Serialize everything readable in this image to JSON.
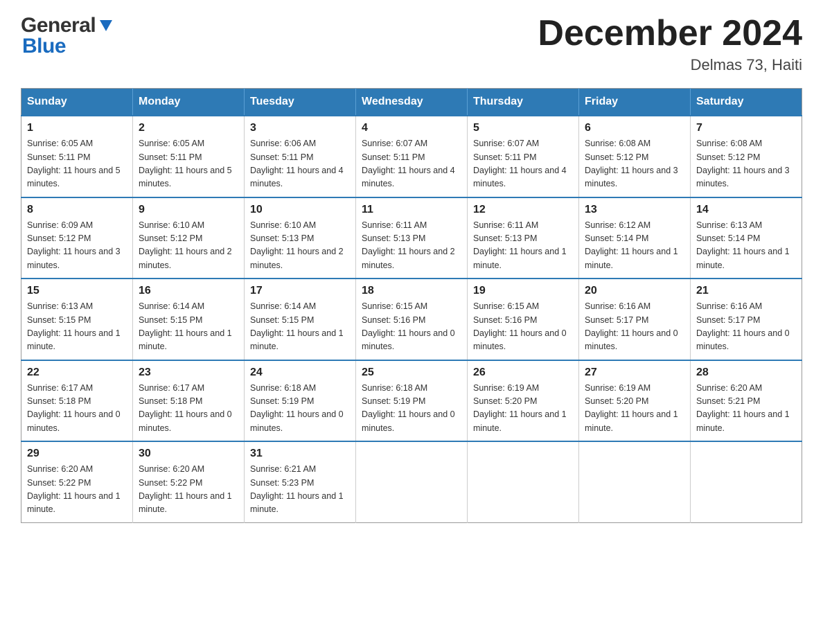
{
  "header": {
    "logo": {
      "general": "General",
      "blue": "Blue"
    },
    "title": "December 2024",
    "location": "Delmas 73, Haiti"
  },
  "calendar": {
    "days_of_week": [
      "Sunday",
      "Monday",
      "Tuesday",
      "Wednesday",
      "Thursday",
      "Friday",
      "Saturday"
    ],
    "weeks": [
      [
        {
          "day": "1",
          "sunrise": "Sunrise: 6:05 AM",
          "sunset": "Sunset: 5:11 PM",
          "daylight": "Daylight: 11 hours and 5 minutes."
        },
        {
          "day": "2",
          "sunrise": "Sunrise: 6:05 AM",
          "sunset": "Sunset: 5:11 PM",
          "daylight": "Daylight: 11 hours and 5 minutes."
        },
        {
          "day": "3",
          "sunrise": "Sunrise: 6:06 AM",
          "sunset": "Sunset: 5:11 PM",
          "daylight": "Daylight: 11 hours and 4 minutes."
        },
        {
          "day": "4",
          "sunrise": "Sunrise: 6:07 AM",
          "sunset": "Sunset: 5:11 PM",
          "daylight": "Daylight: 11 hours and 4 minutes."
        },
        {
          "day": "5",
          "sunrise": "Sunrise: 6:07 AM",
          "sunset": "Sunset: 5:11 PM",
          "daylight": "Daylight: 11 hours and 4 minutes."
        },
        {
          "day": "6",
          "sunrise": "Sunrise: 6:08 AM",
          "sunset": "Sunset: 5:12 PM",
          "daylight": "Daylight: 11 hours and 3 minutes."
        },
        {
          "day": "7",
          "sunrise": "Sunrise: 6:08 AM",
          "sunset": "Sunset: 5:12 PM",
          "daylight": "Daylight: 11 hours and 3 minutes."
        }
      ],
      [
        {
          "day": "8",
          "sunrise": "Sunrise: 6:09 AM",
          "sunset": "Sunset: 5:12 PM",
          "daylight": "Daylight: 11 hours and 3 minutes."
        },
        {
          "day": "9",
          "sunrise": "Sunrise: 6:10 AM",
          "sunset": "Sunset: 5:12 PM",
          "daylight": "Daylight: 11 hours and 2 minutes."
        },
        {
          "day": "10",
          "sunrise": "Sunrise: 6:10 AM",
          "sunset": "Sunset: 5:13 PM",
          "daylight": "Daylight: 11 hours and 2 minutes."
        },
        {
          "day": "11",
          "sunrise": "Sunrise: 6:11 AM",
          "sunset": "Sunset: 5:13 PM",
          "daylight": "Daylight: 11 hours and 2 minutes."
        },
        {
          "day": "12",
          "sunrise": "Sunrise: 6:11 AM",
          "sunset": "Sunset: 5:13 PM",
          "daylight": "Daylight: 11 hours and 1 minute."
        },
        {
          "day": "13",
          "sunrise": "Sunrise: 6:12 AM",
          "sunset": "Sunset: 5:14 PM",
          "daylight": "Daylight: 11 hours and 1 minute."
        },
        {
          "day": "14",
          "sunrise": "Sunrise: 6:13 AM",
          "sunset": "Sunset: 5:14 PM",
          "daylight": "Daylight: 11 hours and 1 minute."
        }
      ],
      [
        {
          "day": "15",
          "sunrise": "Sunrise: 6:13 AM",
          "sunset": "Sunset: 5:15 PM",
          "daylight": "Daylight: 11 hours and 1 minute."
        },
        {
          "day": "16",
          "sunrise": "Sunrise: 6:14 AM",
          "sunset": "Sunset: 5:15 PM",
          "daylight": "Daylight: 11 hours and 1 minute."
        },
        {
          "day": "17",
          "sunrise": "Sunrise: 6:14 AM",
          "sunset": "Sunset: 5:15 PM",
          "daylight": "Daylight: 11 hours and 1 minute."
        },
        {
          "day": "18",
          "sunrise": "Sunrise: 6:15 AM",
          "sunset": "Sunset: 5:16 PM",
          "daylight": "Daylight: 11 hours and 0 minutes."
        },
        {
          "day": "19",
          "sunrise": "Sunrise: 6:15 AM",
          "sunset": "Sunset: 5:16 PM",
          "daylight": "Daylight: 11 hours and 0 minutes."
        },
        {
          "day": "20",
          "sunrise": "Sunrise: 6:16 AM",
          "sunset": "Sunset: 5:17 PM",
          "daylight": "Daylight: 11 hours and 0 minutes."
        },
        {
          "day": "21",
          "sunrise": "Sunrise: 6:16 AM",
          "sunset": "Sunset: 5:17 PM",
          "daylight": "Daylight: 11 hours and 0 minutes."
        }
      ],
      [
        {
          "day": "22",
          "sunrise": "Sunrise: 6:17 AM",
          "sunset": "Sunset: 5:18 PM",
          "daylight": "Daylight: 11 hours and 0 minutes."
        },
        {
          "day": "23",
          "sunrise": "Sunrise: 6:17 AM",
          "sunset": "Sunset: 5:18 PM",
          "daylight": "Daylight: 11 hours and 0 minutes."
        },
        {
          "day": "24",
          "sunrise": "Sunrise: 6:18 AM",
          "sunset": "Sunset: 5:19 PM",
          "daylight": "Daylight: 11 hours and 0 minutes."
        },
        {
          "day": "25",
          "sunrise": "Sunrise: 6:18 AM",
          "sunset": "Sunset: 5:19 PM",
          "daylight": "Daylight: 11 hours and 0 minutes."
        },
        {
          "day": "26",
          "sunrise": "Sunrise: 6:19 AM",
          "sunset": "Sunset: 5:20 PM",
          "daylight": "Daylight: 11 hours and 1 minute."
        },
        {
          "day": "27",
          "sunrise": "Sunrise: 6:19 AM",
          "sunset": "Sunset: 5:20 PM",
          "daylight": "Daylight: 11 hours and 1 minute."
        },
        {
          "day": "28",
          "sunrise": "Sunrise: 6:20 AM",
          "sunset": "Sunset: 5:21 PM",
          "daylight": "Daylight: 11 hours and 1 minute."
        }
      ],
      [
        {
          "day": "29",
          "sunrise": "Sunrise: 6:20 AM",
          "sunset": "Sunset: 5:22 PM",
          "daylight": "Daylight: 11 hours and 1 minute."
        },
        {
          "day": "30",
          "sunrise": "Sunrise: 6:20 AM",
          "sunset": "Sunset: 5:22 PM",
          "daylight": "Daylight: 11 hours and 1 minute."
        },
        {
          "day": "31",
          "sunrise": "Sunrise: 6:21 AM",
          "sunset": "Sunset: 5:23 PM",
          "daylight": "Daylight: 11 hours and 1 minute."
        },
        null,
        null,
        null,
        null
      ]
    ]
  }
}
